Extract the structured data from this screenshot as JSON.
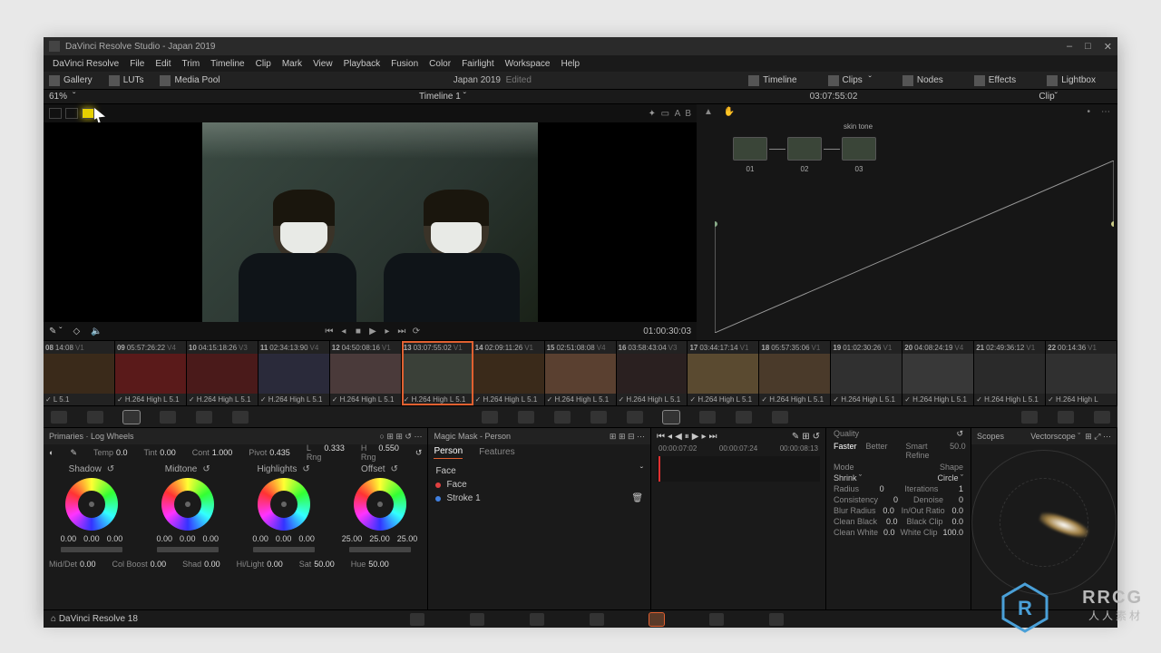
{
  "title": "DaVinci Resolve Studio - Japan 2019",
  "menu": [
    "DaVinci Resolve",
    "File",
    "Edit",
    "Trim",
    "Timeline",
    "Clip",
    "Mark",
    "View",
    "Playback",
    "Fusion",
    "Color",
    "Fairlight",
    "Workspace",
    "Help"
  ],
  "pages": {
    "gallery": "Gallery",
    "luts": "LUTs",
    "mediapool": "Media Pool",
    "timeline": "Timeline",
    "clips": "Clips",
    "nodes": "Nodes",
    "effects": "Effects",
    "lightbox": "Lightbox",
    "project": "Japan 2019",
    "status": "Edited"
  },
  "top": {
    "zoom": "61%",
    "timeline": "Timeline 1",
    "tc": "03:07:55:02",
    "clip": "Clip"
  },
  "viewer": {
    "tc": "01:00:30:03"
  },
  "nodes": {
    "label": "skin tone",
    "n1": "01",
    "n2": "02",
    "n3": "03"
  },
  "clips": [
    {
      "idx": "08",
      "tc": "14:08",
      "v": "V1",
      "codec": "L 5.1"
    },
    {
      "idx": "09",
      "tc": "05:57:26:22",
      "v": "V4",
      "codec": "H.264 High L 5.1"
    },
    {
      "idx": "10",
      "tc": "04:15:18:26",
      "v": "V3",
      "codec": "H.264 High L 5.1"
    },
    {
      "idx": "11",
      "tc": "02:34:13:90",
      "v": "V4",
      "codec": "H.264 High L 5.1"
    },
    {
      "idx": "12",
      "tc": "04:50:08:16",
      "v": "V1",
      "codec": "H.264 High L 5.1"
    },
    {
      "idx": "13",
      "tc": "03:07:55:02",
      "v": "V1",
      "codec": "H.264 High L 5.1"
    },
    {
      "idx": "14",
      "tc": "02:09:11:26",
      "v": "V1",
      "codec": "H.264 High L 5.1"
    },
    {
      "idx": "15",
      "tc": "02:51:08:08",
      "v": "V4",
      "codec": "H.264 High L 5.1"
    },
    {
      "idx": "16",
      "tc": "03:58:43:04",
      "v": "V3",
      "codec": "H.264 High L 5.1"
    },
    {
      "idx": "17",
      "tc": "03:44:17:14",
      "v": "V1",
      "codec": "H.264 High L 5.1"
    },
    {
      "idx": "18",
      "tc": "05:57:35:06",
      "v": "V1",
      "codec": "H.264 High L 5.1"
    },
    {
      "idx": "19",
      "tc": "01:02:30:26",
      "v": "V1",
      "codec": "H.264 High L 5.1"
    },
    {
      "idx": "20",
      "tc": "04:08:24:19",
      "v": "V4",
      "codec": "H.264 High L 5.1"
    },
    {
      "idx": "21",
      "tc": "02:49:36:12",
      "v": "V1",
      "codec": "H.264 High L 5.1"
    },
    {
      "idx": "22",
      "tc": "00:14:36",
      "v": "V1",
      "codec": "H.264 High L"
    }
  ],
  "primaries": {
    "title": "Primaries · Log Wheels",
    "temp": {
      "lbl": "Temp",
      "val": "0.0"
    },
    "tint": {
      "lbl": "Tint",
      "val": "0.00"
    },
    "cont": {
      "lbl": "Cont",
      "val": "1.000"
    },
    "pivot": {
      "lbl": "Pivot",
      "val": "0.435"
    },
    "lrng": {
      "lbl": "L Rng",
      "val": "0.333"
    },
    "hrng": {
      "lbl": "H Rng",
      "val": "0.550"
    },
    "wheels": [
      {
        "name": "Shadow",
        "vals": [
          "0.00",
          "0.00",
          "0.00"
        ]
      },
      {
        "name": "Midtone",
        "vals": [
          "0.00",
          "0.00",
          "0.00"
        ]
      },
      {
        "name": "Highlights",
        "vals": [
          "0.00",
          "0.00",
          "0.00"
        ]
      },
      {
        "name": "Offset",
        "vals": [
          "25.00",
          "25.00",
          "25.00"
        ]
      }
    ],
    "row2": {
      "middet": {
        "lbl": "Mid/Det",
        "val": "0.00"
      },
      "colboost": {
        "lbl": "Col Boost",
        "val": "0.00"
      },
      "shad": {
        "lbl": "Shad",
        "val": "0.00"
      },
      "hilight": {
        "lbl": "Hi/Light",
        "val": "0.00"
      },
      "sat": {
        "lbl": "Sat",
        "val": "50.00"
      },
      "hue": {
        "lbl": "Hue",
        "val": "50.00"
      }
    }
  },
  "mask": {
    "title": "Magic Mask - Person",
    "tabs": [
      "Person",
      "Features"
    ],
    "section": "Face",
    "items": [
      "Face",
      "Stroke 1"
    ],
    "times": [
      "00:00:07:02",
      "00:00:07:24",
      "00:00:08:13"
    ]
  },
  "adj": {
    "quality": "Quality",
    "faster": "Faster",
    "better": "Better",
    "smartrefine": {
      "lbl": "Smart Refine",
      "val": "50.0"
    },
    "mode": "Mode",
    "shape": "Shape",
    "shrink": "Shrink",
    "circle": "Circle",
    "radius": {
      "lbl": "Radius",
      "val": "0"
    },
    "iter": {
      "lbl": "Iterations",
      "val": "1"
    },
    "consist": {
      "lbl": "Consistency",
      "val": "0"
    },
    "denoise": {
      "lbl": "Denoise",
      "val": "0"
    },
    "blur": {
      "lbl": "Blur Radius",
      "val": "0.0"
    },
    "inout": {
      "lbl": "In/Out Ratio",
      "val": "0.0"
    },
    "cblack": {
      "lbl": "Clean Black",
      "val": "0.0"
    },
    "bclip": {
      "lbl": "Black Clip",
      "val": "0.0"
    },
    "cwhite": {
      "lbl": "Clean White",
      "val": "0.0"
    },
    "wclip": {
      "lbl": "White Clip",
      "val": "100.0"
    }
  },
  "scope": {
    "title": "Scopes",
    "type": "Vectorscope"
  },
  "status": {
    "app": "DaVinci Resolve 18"
  },
  "watermark": {
    "l1": "RRCG",
    "l2": "人人素材"
  }
}
